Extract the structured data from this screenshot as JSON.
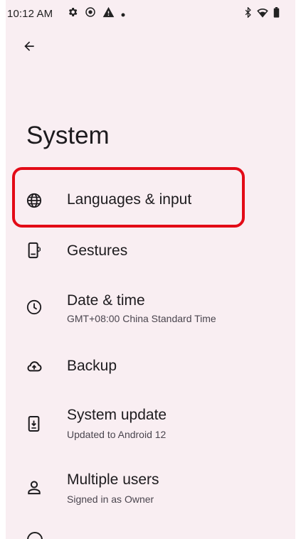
{
  "status_bar": {
    "time": "10:12 AM",
    "left_icons": [
      "settings-gear-icon",
      "media-record-icon",
      "warning-icon",
      "dot-icon"
    ],
    "right_icons": [
      "bluetooth-icon",
      "wifi-icon",
      "battery-icon"
    ]
  },
  "header": {
    "back_icon": "arrow-back-icon"
  },
  "page": {
    "title": "System"
  },
  "items": [
    {
      "icon": "globe-icon",
      "title": "Languages & input",
      "summary": ""
    },
    {
      "icon": "gestures-phone-icon",
      "title": "Gestures",
      "summary": ""
    },
    {
      "icon": "clock-icon",
      "title": "Date & time",
      "summary": "GMT+08:00 China Standard Time"
    },
    {
      "icon": "cloud-upload-icon",
      "title": "Backup",
      "summary": ""
    },
    {
      "icon": "system-update-icon",
      "title": "System update",
      "summary": "Updated to Android 12"
    },
    {
      "icon": "person-icon",
      "title": "Multiple users",
      "summary": "Signed in as Owner"
    }
  ],
  "highlight": {
    "target": "Languages & input",
    "color": "#e30b17"
  },
  "colors": {
    "background": "#f9eef2",
    "text_primary": "#1d1b1e",
    "text_secondary": "#4a454e"
  }
}
